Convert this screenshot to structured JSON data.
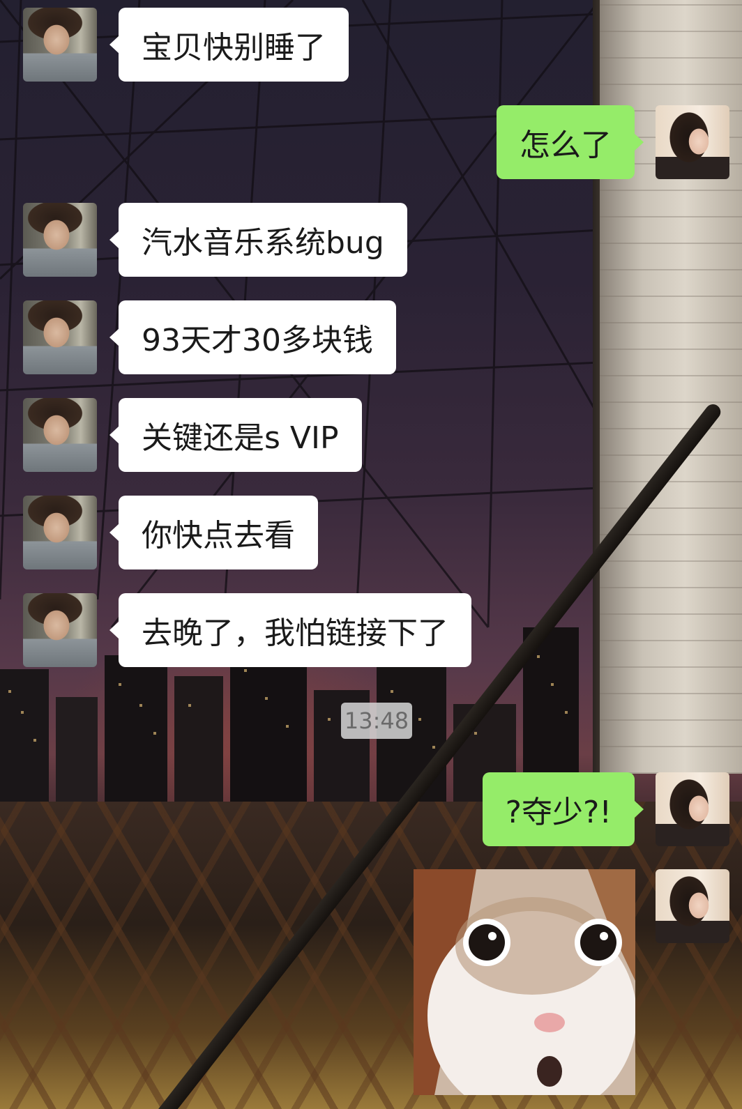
{
  "chat": {
    "messages": [
      {
        "sender": "other",
        "text": "宝贝快别睡了"
      },
      {
        "sender": "self",
        "text": "怎么了"
      },
      {
        "sender": "other",
        "text": "汽水音乐系统bug"
      },
      {
        "sender": "other",
        "text": "93天才30多块钱"
      },
      {
        "sender": "other",
        "text": "关键还是s VIP"
      },
      {
        "sender": "other",
        "text": "你快点去看"
      },
      {
        "sender": "other",
        "text": "去晚了，我怕链接下了"
      },
      {
        "sender": "system",
        "text": "13:48"
      },
      {
        "sender": "self",
        "text": "?夺少?!"
      },
      {
        "sender": "self",
        "type": "sticker",
        "sticker": "surprised-cat"
      }
    ]
  },
  "colors": {
    "self_bubble": "#95ec69",
    "other_bubble": "#ffffff",
    "timestamp_bg": "#d2d2d2"
  },
  "icons": {
    "other_avatar": "boy-avatar",
    "self_avatar": "girl-avatar",
    "sticker": "surprised-cat-sticker"
  }
}
